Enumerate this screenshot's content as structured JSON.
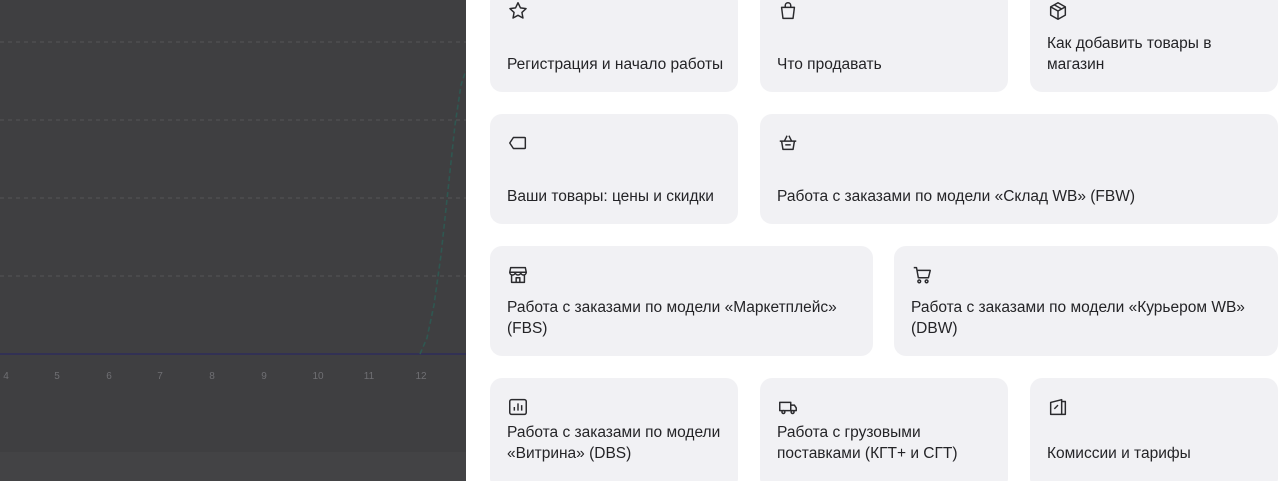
{
  "background_chart": {
    "x_ticks": [
      "4",
      "5",
      "6",
      "7",
      "8",
      "9",
      "10",
      "11",
      "12"
    ]
  },
  "help_panel": {
    "cards": [
      {
        "icon": "star-icon",
        "label": "Регистрация и начало работы"
      },
      {
        "icon": "bag-icon",
        "label": "Что продавать"
      },
      {
        "icon": "box-icon",
        "label": "Как добавить товары в магазин"
      },
      {
        "icon": "tag-icon",
        "label": "Ваши товары: цены и скидки"
      },
      {
        "icon": "basket-icon",
        "label": "Работа с заказами по модели «Склад WB» (FBW)"
      },
      {
        "icon": "store-icon",
        "label": "Работа с заказами по модели «Маркетплейс» (FBS)"
      },
      {
        "icon": "cart-icon",
        "label": "Работа с заказами по модели «Курьером WB» (DBW)"
      },
      {
        "icon": "chart-icon",
        "label": "Работа с заказами по модели «Витрина» (DBS)"
      },
      {
        "icon": "truck-icon",
        "label": "Работа с грузовыми поставками (КГТ+ и СГТ)"
      },
      {
        "icon": "percent-document-icon",
        "label": "Комиссии и тарифы"
      }
    ]
  }
}
